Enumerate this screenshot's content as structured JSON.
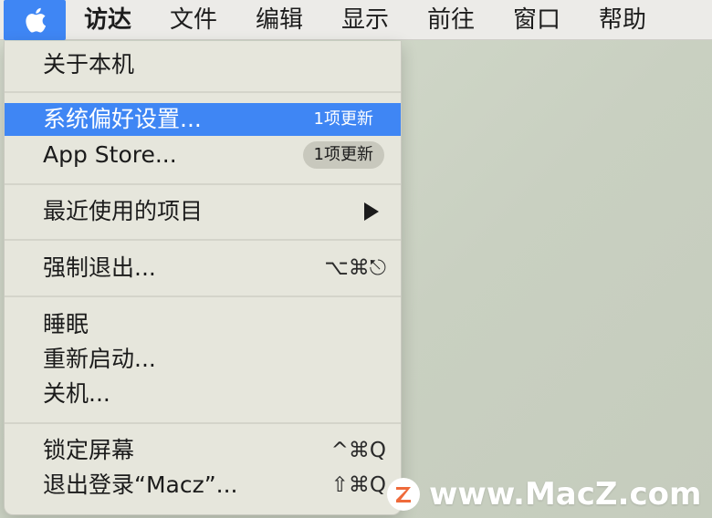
{
  "menubar": {
    "apple_icon": "apple-logo-icon",
    "items": [
      "访达",
      "文件",
      "编辑",
      "显示",
      "前往",
      "窗口",
      "帮助"
    ]
  },
  "menu": {
    "about": "关于本机",
    "preferences": "系统偏好设置...",
    "preferences_badge": "1项更新",
    "app_store": "App Store...",
    "app_store_badge": "1项更新",
    "recent": "最近使用的项目",
    "force_quit": "强制退出...",
    "force_quit_shortcut": "⌥⌘⎋",
    "sleep": "睡眠",
    "restart": "重新启动...",
    "shutdown": "关机...",
    "lock_screen": "锁定屏幕",
    "lock_screen_shortcut": "^⌘Q",
    "logout": "退出登录“Macz”...",
    "logout_shortcut": "⇧⌘Q"
  },
  "watermark": {
    "text": "www.MacZ.com"
  },
  "colors": {
    "highlight": "#3f86f4",
    "menu_bg": "#e6e6dc",
    "badge_bg": "#c8c8bd",
    "wm_accent": "#ef6a3a"
  }
}
